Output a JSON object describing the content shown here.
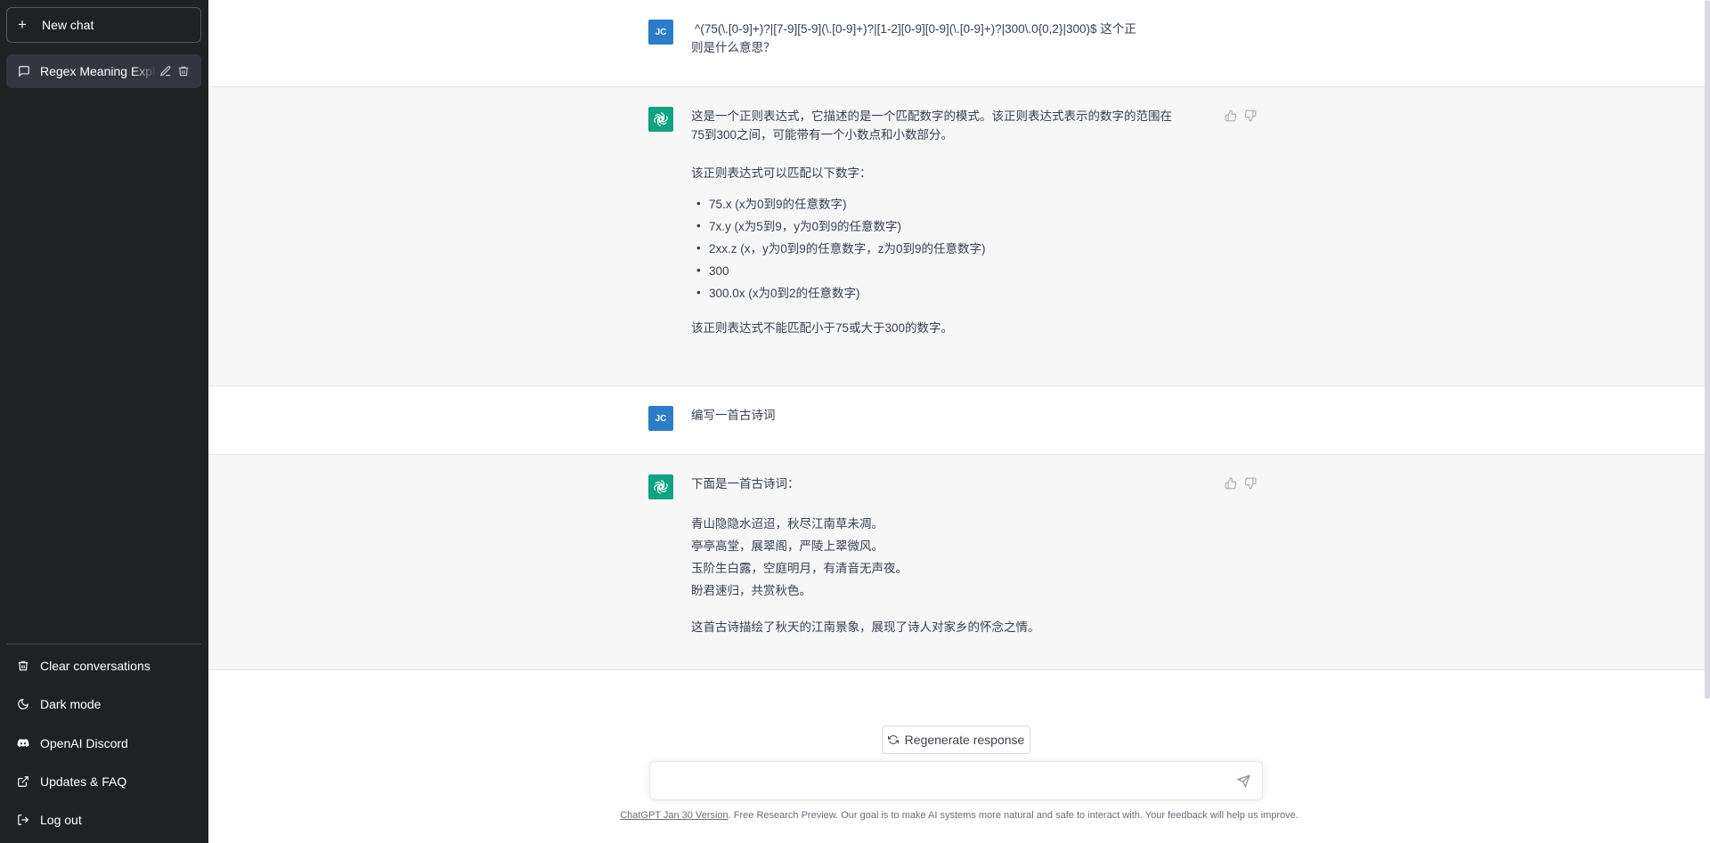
{
  "sidebar": {
    "new_chat_label": "New chat",
    "conversations": [
      {
        "title": "Regex Meaning Explained"
      }
    ],
    "menu": [
      {
        "label": "Clear conversations",
        "icon": "trash-icon"
      },
      {
        "label": "Dark mode",
        "icon": "moon-icon"
      },
      {
        "label": "OpenAI Discord",
        "icon": "discord-icon"
      },
      {
        "label": "Updates & FAQ",
        "icon": "external-link-icon"
      },
      {
        "label": "Log out",
        "icon": "logout-icon"
      }
    ]
  },
  "user_avatar_initials": "JC",
  "thread": [
    {
      "role": "user",
      "line1": "^(75(\\.[0-9]+)?|[7-9][5-9](\\.[0-9]+)?|[1-2][0-9][0-9](\\.[0-9]+)?|300\\.0{0,2}|300)$ 这个正",
      "line2": "则是什么意思？"
    },
    {
      "role": "assistant",
      "p1_line1": "这是一个正则表达式，它描述的是一个匹配数字的模式。该正则表达式表示的数字的范围在",
      "p1_line2": "75到300之间，可能带有一个小数点和小数部分。",
      "p2": "该正则表达式可以匹配以下数字：",
      "items": [
        "75.x (x为0到9的任意数字)",
        "7x.y (x为5到9，y为0到9的任意数字)",
        "2xx.z (x，y为0到9的任意数字，z为0到9的任意数字)",
        "300",
        "300.0x (x为0到2的任意数字)"
      ],
      "p3": "该正则表达式不能匹配小于75或大于300的数字。"
    },
    {
      "role": "user",
      "text": "编写一首古诗词"
    },
    {
      "role": "assistant",
      "intro": "下面是一首古诗词：",
      "poem": [
        "青山隐隐水迢迢，秋尽江南草未凋。",
        "亭亭高堂，展翠阁，严陵上翠微风。",
        "玉阶生白露，空庭明月，有清音无声夜。",
        "盼君速归，共赏秋色。"
      ],
      "outro": "这首古诗描绘了秋天的江南景象，展现了诗人对家乡的怀念之情。"
    }
  ],
  "regenerate_label": "Regenerate response",
  "input": {
    "placeholder": ""
  },
  "footer": {
    "version_link": "ChatGPT Jan 30 Version",
    "text": ". Free Research Preview. Our goal is to make AI systems more natural and safe to interact with. Your feedback will help us improve."
  },
  "colors": {
    "sidebar_bg": "#202123",
    "assistant_bg": "#f7f7f8",
    "gpt_avatar": "#10a37f",
    "user_avatar": "#2b7cc9"
  }
}
